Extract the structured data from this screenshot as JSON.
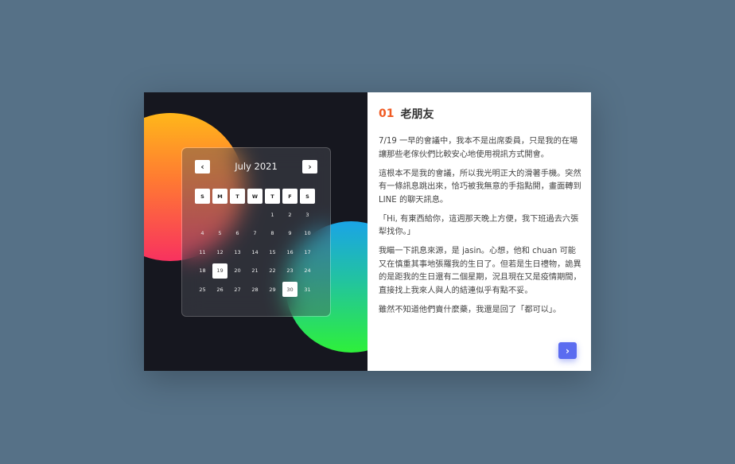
{
  "calendar": {
    "month": "July 2021",
    "prev_icon": "‹",
    "next_icon": "›",
    "weekdays": [
      "S",
      "M",
      "T",
      "W",
      "T",
      "F",
      "S"
    ],
    "days": [
      "",
      "",
      "",
      "",
      "1",
      "2",
      "3",
      "4",
      "5",
      "6",
      "7",
      "8",
      "9",
      "10",
      "11",
      "12",
      "13",
      "14",
      "15",
      "16",
      "17",
      "18",
      "19",
      "20",
      "21",
      "22",
      "23",
      "24",
      "25",
      "26",
      "27",
      "28",
      "29",
      "30",
      "31"
    ],
    "selected": [
      "19",
      "30"
    ]
  },
  "article": {
    "number": "01",
    "title": "老朋友",
    "paragraphs": [
      "7/19 一早的會議中，我本不是出席委員，只是我的在場讓那些老傢伙們比較安心地使用視訊方式開會。",
      "這根本不是我的會議，所以我光明正大的滑著手機。突然有一條訊息跳出來，恰巧被我無意的手指點開，畫面轉到 LINE 的聊天訊息。",
      "「Hi, 有東西給你，這週那天晚上方便，我下班過去六張犁找你。」",
      "我瞄一下訊息來源，是 jasin。心想，他和 chuan 可能又在慎重其事地張羅我的生日了。但若是生日禮物，詭異的是距我的生日還有二個星期，況且現在又是疫情期間，直接找上我來人與人的結連似乎有點不妥。",
      "雖然不知道他們賣什麼藥，我還是回了「都可以」。"
    ],
    "next_icon": "›"
  },
  "colors": {
    "background": "#567187",
    "accent_number": "#f05a22",
    "next_button": "#5b6cf0"
  }
}
